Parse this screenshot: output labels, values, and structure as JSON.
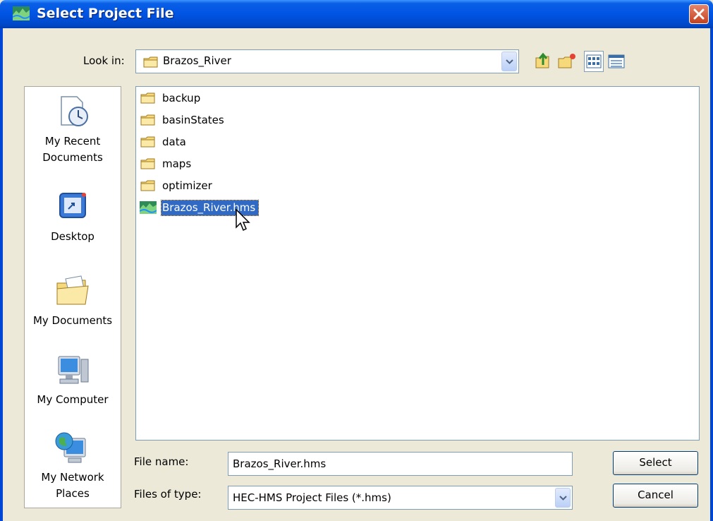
{
  "window": {
    "title": "Select Project File",
    "title_icon": "hec-hms-icon"
  },
  "toolbar": {
    "look_in_label": "Look in:",
    "look_in_value": "Brazos_River",
    "buttons": [
      "up-one-level-icon",
      "create-new-folder-icon",
      "list-view-icon",
      "details-view-icon"
    ]
  },
  "places": [
    {
      "label": "My Recent Documents",
      "line1": "My Recent",
      "line2": "Documents",
      "icon": "recent-documents-icon"
    },
    {
      "label": "Desktop",
      "line1": "Desktop",
      "line2": "",
      "icon": "desktop-icon"
    },
    {
      "label": "My Documents",
      "line1": "My Documents",
      "line2": "",
      "icon": "my-documents-icon"
    },
    {
      "label": "My Computer",
      "line1": "My Computer",
      "line2": "",
      "icon": "my-computer-icon"
    },
    {
      "label": "My Network Places",
      "line1": "My Network",
      "line2": "Places",
      "icon": "network-places-icon"
    }
  ],
  "files": [
    {
      "name": "backup",
      "type": "folder"
    },
    {
      "name": "basinStates",
      "type": "folder"
    },
    {
      "name": "data",
      "type": "folder"
    },
    {
      "name": "maps",
      "type": "folder"
    },
    {
      "name": "optimizer",
      "type": "folder"
    },
    {
      "name": "Brazos_River.hms",
      "type": "hms-file",
      "selected": true
    }
  ],
  "file_name": {
    "label": "File name:",
    "value": "Brazos_River.hms"
  },
  "file_type": {
    "label": "Files of type:",
    "value": "HEC-HMS Project Files (*.hms)"
  },
  "buttons": {
    "select": "Select",
    "cancel": "Cancel"
  },
  "colors": {
    "titlebar": "#0054E3",
    "selection": "#316AC5",
    "dialog_bg": "#ECE9D8"
  }
}
